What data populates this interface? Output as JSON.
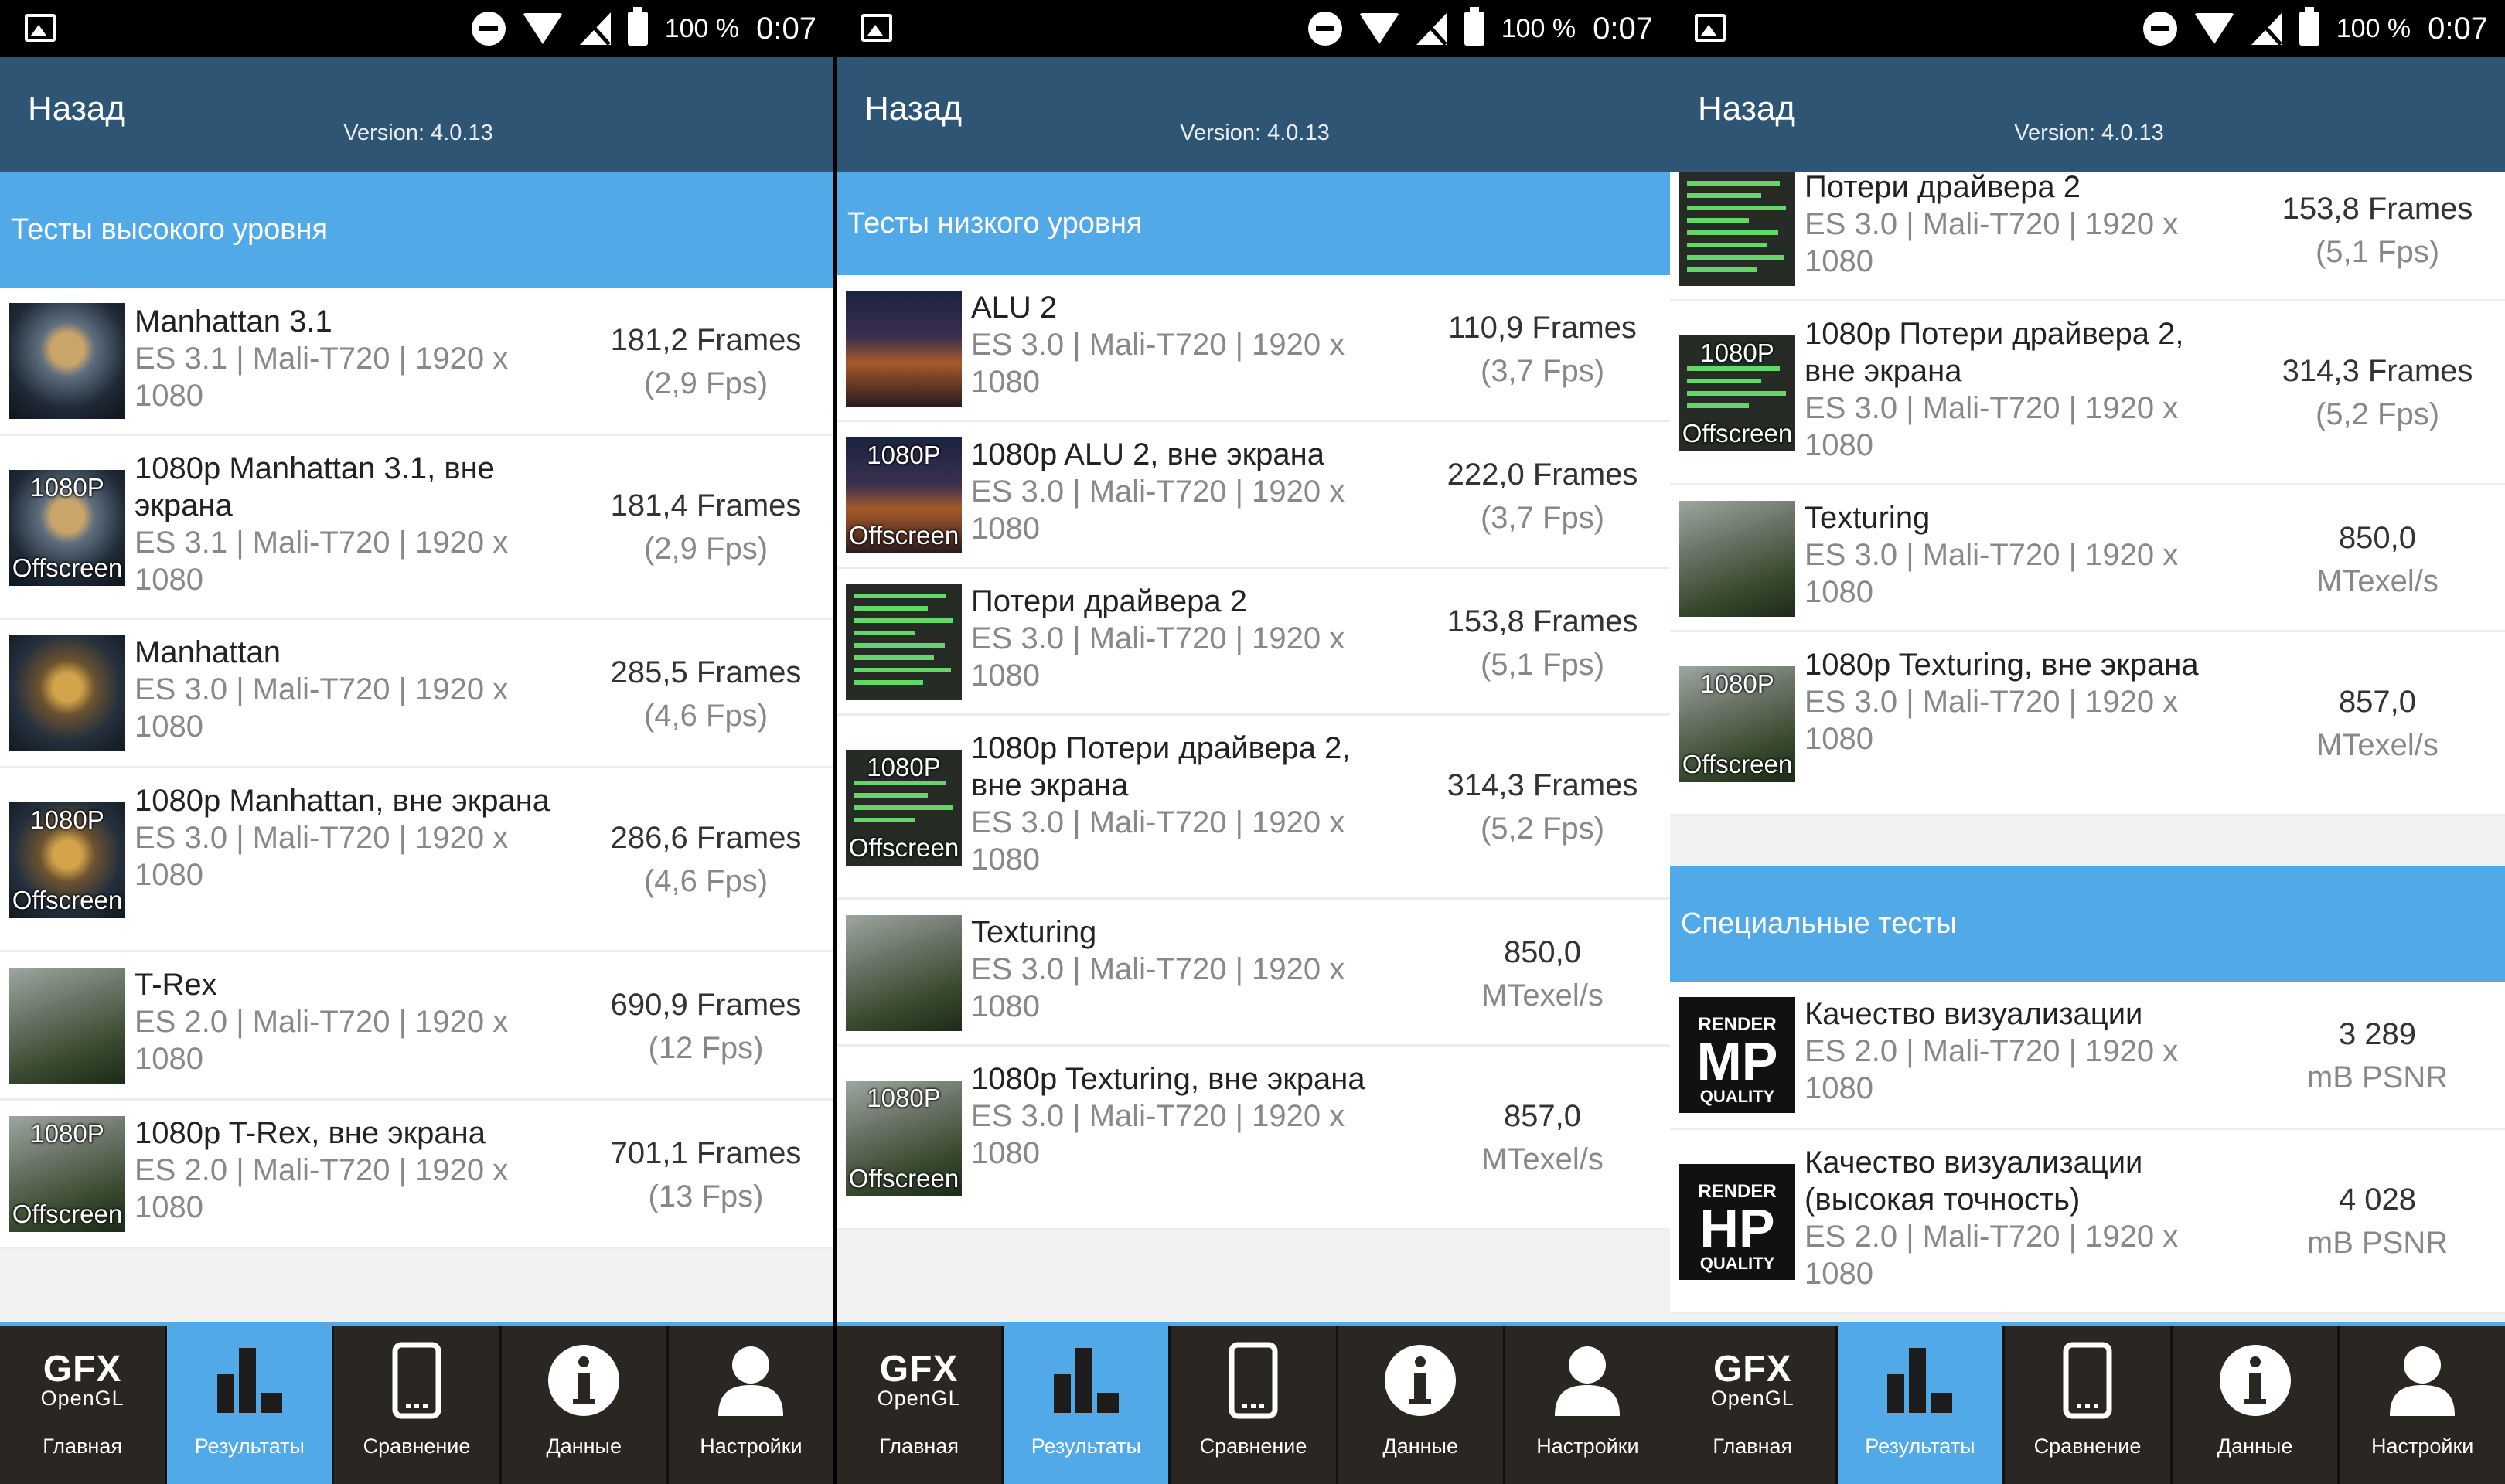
{
  "status": {
    "battery": "100 %",
    "time": "0:07"
  },
  "appbar": {
    "back_label": "Назад",
    "version": "Version: 4.0.13"
  },
  "nav": [
    {
      "label": "Главная",
      "icon": "gfx-opengl-logo"
    },
    {
      "label": "Результаты",
      "icon": "bar-chart-icon"
    },
    {
      "label": "Сравнение",
      "icon": "phone-icon"
    },
    {
      "label": "Данные",
      "icon": "info-icon"
    },
    {
      "label": "Настройки",
      "icon": "user-icon"
    }
  ],
  "logo": {
    "gfx": "GFX",
    "opengl": "OpenGL"
  },
  "badges": {
    "res": "1080P",
    "offscreen": "Offscreen"
  },
  "render_badge": {
    "render": "RENDER",
    "mp": "MP",
    "hp": "HP",
    "quality": "QUALITY"
  },
  "panel1": {
    "section": "Тесты высокого уровня",
    "rows": [
      {
        "name": "Manhattan 3.1",
        "api": "ES 3.1 | Mali-T720 | 1920 x",
        "res": "1080",
        "score": "181,2 Frames",
        "fps": "(2,9 Fps)"
      },
      {
        "name": "1080p Manhattan 3.1, вне экрана",
        "api": "ES 3.1 | Mali-T720 | 1920 x",
        "res": "1080",
        "score": "181,4 Frames",
        "fps": "(2,9 Fps)"
      },
      {
        "name": "Manhattan",
        "api": "ES 3.0 | Mali-T720 | 1920 x",
        "res": "1080",
        "score": "285,5 Frames",
        "fps": "(4,6 Fps)"
      },
      {
        "name": "1080p Manhattan, вне экрана",
        "api": "ES 3.0 | Mali-T720 | 1920 x",
        "res": "1080",
        "score": "286,6 Frames",
        "fps": "(4,6 Fps)"
      },
      {
        "name": "T-Rex",
        "api": "ES 2.0 | Mali-T720 | 1920 x",
        "res": "1080",
        "score": "690,9 Frames",
        "fps": "(12 Fps)"
      },
      {
        "name": "1080p T-Rex, вне экрана",
        "api": "ES 2.0 | Mali-T720 | 1920 x",
        "res": "1080",
        "score": "701,1 Frames",
        "fps": "(13 Fps)"
      }
    ]
  },
  "panel2": {
    "section": "Тесты низкого уровня",
    "rows": [
      {
        "name": "ALU 2",
        "api": "ES 3.0 | Mali-T720 | 1920 x",
        "res": "1080",
        "score": "110,9 Frames",
        "fps": "(3,7 Fps)"
      },
      {
        "name": "1080p ALU 2, вне экрана",
        "api": "ES 3.0 | Mali-T720 | 1920 x",
        "res": "1080",
        "score": "222,0 Frames",
        "fps": "(3,7 Fps)"
      },
      {
        "name": "Потери драйвера 2",
        "api": "ES 3.0 | Mali-T720 | 1920 x",
        "res": "1080",
        "score": "153,8 Frames",
        "fps": "(5,1 Fps)"
      },
      {
        "name": "1080p Потери драйвера 2, вне экрана",
        "api": "ES 3.0 | Mali-T720 | 1920 x",
        "res": "1080",
        "score": "314,3 Frames",
        "fps": "(5,2 Fps)"
      },
      {
        "name": "Texturing",
        "api": "ES 3.0 | Mali-T720 | 1920 x",
        "res": "1080",
        "score": "850,0",
        "fps": "MTexel/s"
      },
      {
        "name": "1080p Texturing, вне экрана",
        "api": "ES 3.0 | Mali-T720 | 1920 x",
        "res": "1080",
        "score": "857,0",
        "fps": "MTexel/s"
      }
    ]
  },
  "panel3": {
    "rows": [
      {
        "name": "Потери драйвера 2",
        "api": "ES 3.0 | Mali-T720 | 1920 x",
        "res": "1080",
        "score": "153,8 Frames",
        "fps": "(5,1 Fps)"
      },
      {
        "name": "1080p Потери драйвера 2, вне экрана",
        "api": "ES 3.0 | Mali-T720 | 1920 x",
        "res": "1080",
        "score": "314,3 Frames",
        "fps": "(5,2 Fps)"
      },
      {
        "name": "Texturing",
        "api": "ES 3.0 | Mali-T720 | 1920 x",
        "res": "1080",
        "score": "850,0",
        "fps": "MTexel/s"
      },
      {
        "name": "1080p Texturing, вне экрана",
        "api": "ES 3.0 | Mali-T720 | 1920 x",
        "res": "1080",
        "score": "857,0",
        "fps": "MTexel/s"
      }
    ],
    "section": "Специальные тесты",
    "special_rows": [
      {
        "name": "Качество визуализации",
        "api": "ES 2.0 | Mali-T720 | 1920 x",
        "res": "1080",
        "score": "3 289",
        "fps": "mB PSNR"
      },
      {
        "name": "Качество визуализации (высокая точность)",
        "api": "ES 2.0 | Mali-T720 | 1920 x",
        "res": "1080",
        "score": "4 028",
        "fps": "mB PSNR"
      }
    ]
  },
  "colors": {
    "appbar": "#2e5573",
    "accent": "#52a9e8",
    "nav": "#2a2622"
  }
}
